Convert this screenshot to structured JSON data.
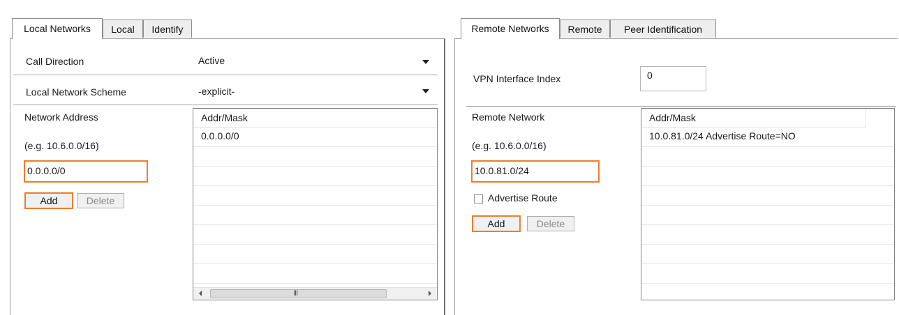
{
  "left": {
    "tabs": [
      {
        "label": "Local Networks",
        "active": true
      },
      {
        "label": "Local",
        "active": false
      },
      {
        "label": "Identify",
        "active": false
      }
    ],
    "call_direction": {
      "label": "Call Direction",
      "value": "Active"
    },
    "local_network_scheme": {
      "label": "Local Network Scheme",
      "value": "-explicit-"
    },
    "network_address": {
      "label": "Network Address",
      "hint": "(e.g. 10.6.0.0/16)",
      "value": "0.0.0.0/0"
    },
    "buttons": {
      "add": "Add",
      "delete": "Delete"
    },
    "table": {
      "header": "Addr/Mask",
      "rows": [
        "0.0.0.0/0"
      ],
      "scroll_grip": "III"
    }
  },
  "right": {
    "tabs": [
      {
        "label": "Remote Networks",
        "active": true
      },
      {
        "label": "Remote",
        "active": false
      },
      {
        "label": "Peer Identification",
        "active": false
      }
    ],
    "vpn_interface_index": {
      "label": "VPN Interface Index",
      "value": "0"
    },
    "remote_network": {
      "label": "Remote Network",
      "hint": "(e.g. 10.6.0.0/16)",
      "value": "10.0.81.0/24"
    },
    "advertise_route": {
      "label": "Advertise Route",
      "checked": false
    },
    "buttons": {
      "add": "Add",
      "delete": "Delete"
    },
    "table": {
      "header": "Addr/Mask",
      "rows": [
        "10.0.81.0/24 Advertise Route=NO"
      ]
    }
  },
  "colors": {
    "highlight": "#ee7d2e",
    "border": "#a0a0a0"
  }
}
